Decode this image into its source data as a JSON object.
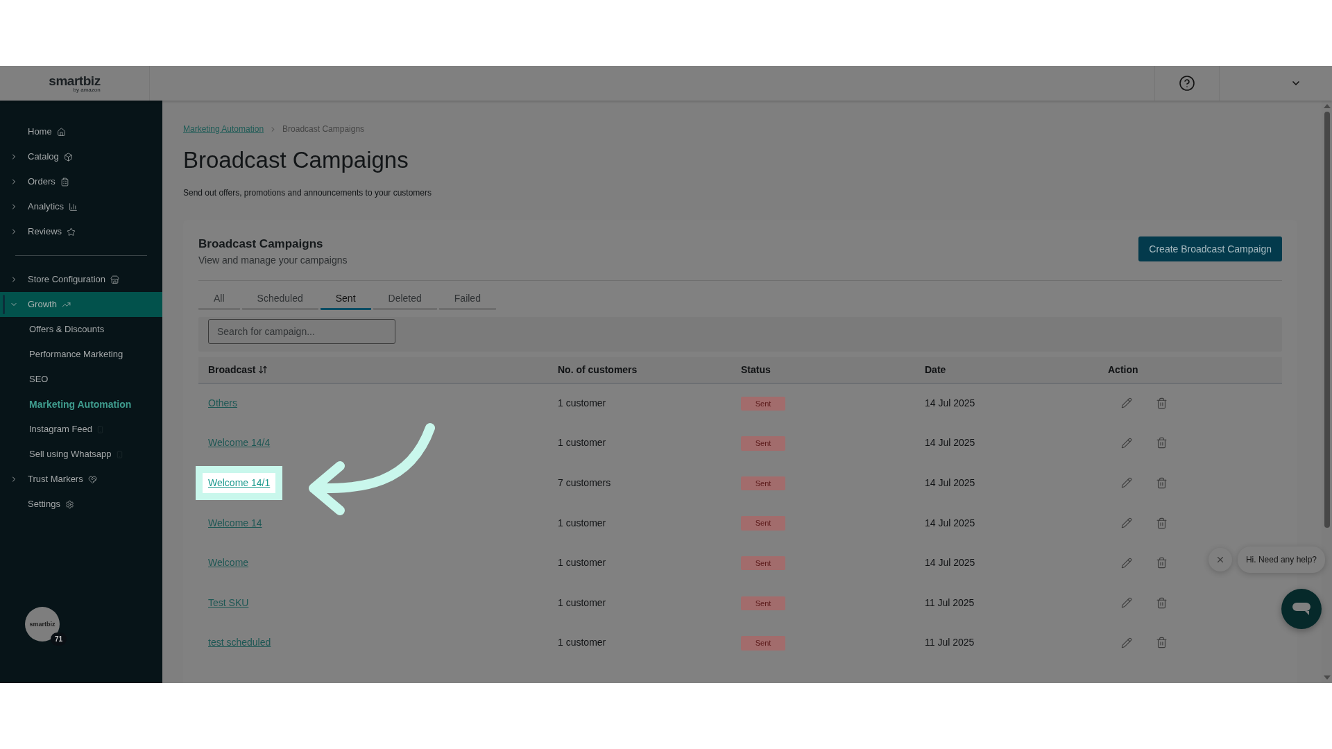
{
  "header": {
    "logo": "smartbiz",
    "logo_sub": "by amazon"
  },
  "sidebar": {
    "items": [
      {
        "label": "Home",
        "selected": false
      },
      {
        "label": "Catalog",
        "expanded": false,
        "selected": false
      },
      {
        "label": "Orders",
        "expanded": false,
        "selected": false
      },
      {
        "label": "Analytics",
        "expanded": false,
        "selected": false
      },
      {
        "label": "Reviews",
        "expanded": false,
        "selected": false
      },
      {
        "kind": "divider"
      },
      {
        "label": "Store Configuration",
        "expanded": false,
        "selected": false
      },
      {
        "label": "Growth",
        "expanded": true,
        "selected": true,
        "children": [
          {
            "label": "Offers & Discounts",
            "selected": false
          },
          {
            "label": "Performance Marketing",
            "selected": false
          },
          {
            "label": "SEO",
            "selected": false
          },
          {
            "label": "Marketing Automation",
            "selected": true
          },
          {
            "label": "Instagram Feed",
            "selected": false
          },
          {
            "label": "Sell using Whatsapp",
            "selected": false
          }
        ]
      },
      {
        "label": "Trust Markers",
        "expanded": false,
        "selected": false
      },
      {
        "label": "Settings",
        "selected": false
      }
    ],
    "avatar": {
      "logo": "smartbiz",
      "badge": "71"
    }
  },
  "breadcrumb": [
    {
      "label": "Marketing Automation",
      "link": true
    },
    {
      "label": "Broadcast Campaigns",
      "link": false
    }
  ],
  "page": {
    "title": "Broadcast Campaigns",
    "subtitle": "Send out offers, promotions and announcements to your customers"
  },
  "card": {
    "title": "Broadcast Campaigns",
    "subtitle": "View and manage your campaigns",
    "create_button": "Create Broadcast Campaign"
  },
  "tabs": [
    {
      "label": "All",
      "selected": false
    },
    {
      "label": "Scheduled",
      "selected": false
    },
    {
      "label": "Sent",
      "selected": true
    },
    {
      "label": "Deleted",
      "selected": false
    },
    {
      "label": "Failed",
      "selected": false
    }
  ],
  "search": {
    "placeholder": "Search for campaign..."
  },
  "table": {
    "columns": [
      "Broadcast",
      "No. of customers",
      "Status",
      "Date",
      "Action"
    ],
    "rows": [
      {
        "name": "Others",
        "customers": "1 customer",
        "status": "Sent",
        "date": "14 Jul 2025",
        "highlighted": false
      },
      {
        "name": "Welcome 14/4",
        "customers": "1 customer",
        "status": "Sent",
        "date": "14 Jul 2025",
        "highlighted": false
      },
      {
        "name": "Welcome 14/1",
        "customers": "7 customers",
        "status": "Sent",
        "date": "14 Jul 2025",
        "highlighted": true
      },
      {
        "name": "Welcome 14",
        "customers": "1 customer",
        "status": "Sent",
        "date": "14 Jul 2025",
        "highlighted": false
      },
      {
        "name": "Welcome",
        "customers": "1 customer",
        "status": "Sent",
        "date": "14 Jul 2025",
        "highlighted": false
      },
      {
        "name": "Test SKU",
        "customers": "1 customer",
        "status": "Sent",
        "date": "11 Jul 2025",
        "highlighted": false
      },
      {
        "name": "test scheduled",
        "customers": "1 customer",
        "status": "Sent",
        "date": "11 Jul 2025",
        "highlighted": false
      }
    ]
  },
  "chat": {
    "message": "Hi. Need any help?"
  }
}
